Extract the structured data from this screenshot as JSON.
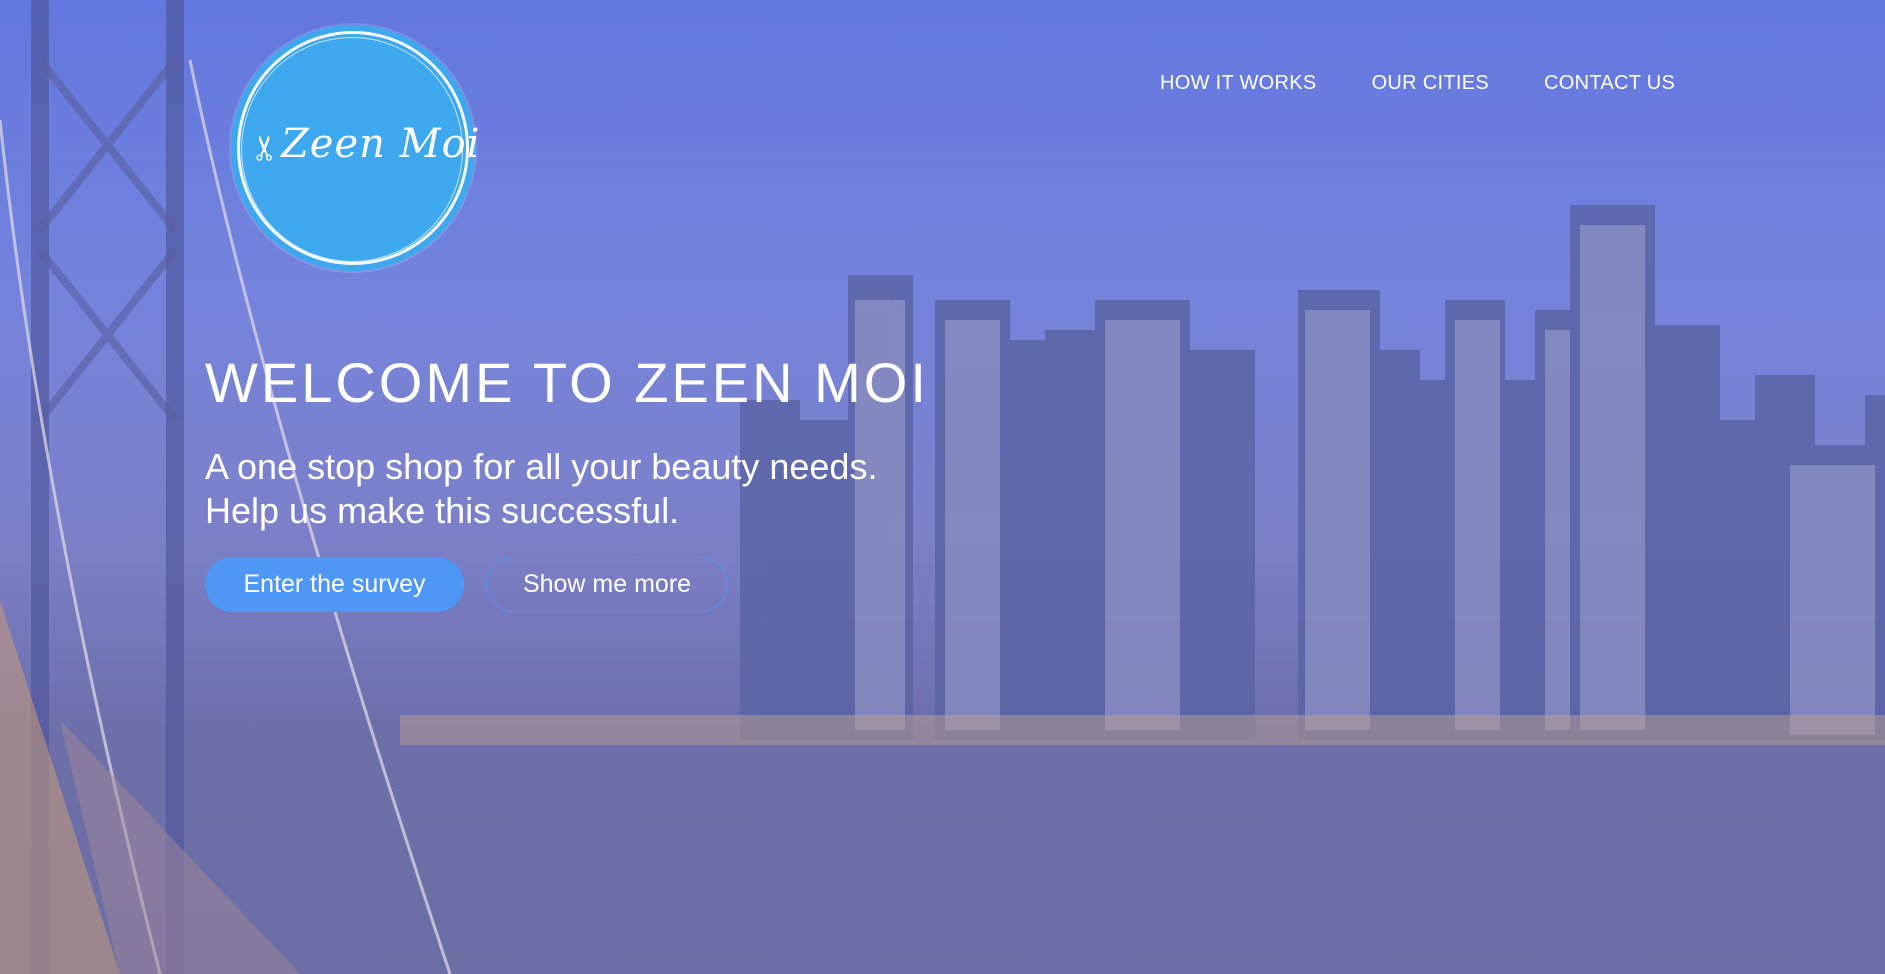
{
  "logo": {
    "text": "Zeen Moi",
    "icon": "scissors-icon"
  },
  "nav": {
    "items": [
      "HOW IT WORKS",
      "OUR CITIES",
      "CONTACT US"
    ]
  },
  "hero": {
    "headline": "WELCOME TO ZEEN MOI",
    "subtitle_line1": "A one stop shop for all your beauty needs.",
    "subtitle_line2": "Help us make this successful.",
    "primary_button": "Enter the survey",
    "secondary_button": "Show me more"
  },
  "colors": {
    "accent": "#4f97f4",
    "logo_bg": "#3ea8ef",
    "overlay": "#6277df"
  }
}
